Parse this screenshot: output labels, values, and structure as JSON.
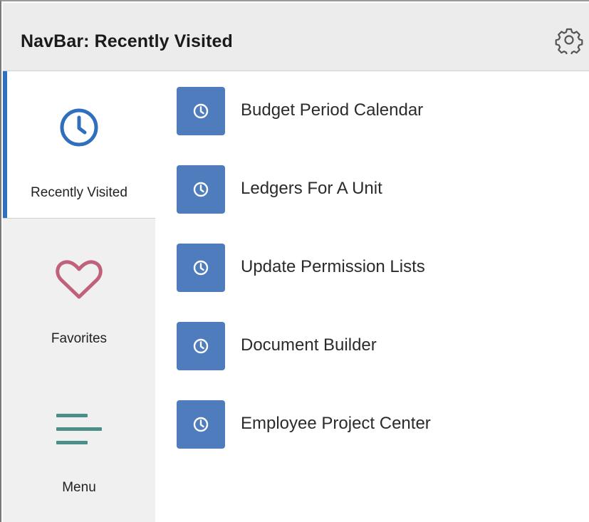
{
  "header": {
    "title": "NavBar: Recently Visited",
    "settings_icon": "gear-icon"
  },
  "sidebar": {
    "items": [
      {
        "label": "Recently Visited",
        "icon": "clock-icon",
        "active": true,
        "color": "#2f6fbd"
      },
      {
        "label": "Favorites",
        "icon": "heart-icon",
        "active": false,
        "color": "#c0607a"
      },
      {
        "label": "Menu",
        "icon": "menu-icon",
        "active": false,
        "color": "#4a8f87"
      }
    ]
  },
  "recent_items": [
    {
      "label": "Budget Period Calendar",
      "icon": "clock-icon"
    },
    {
      "label": "Ledgers For A Unit",
      "icon": "clock-icon"
    },
    {
      "label": "Update Permission Lists",
      "icon": "clock-icon"
    },
    {
      "label": "Document Builder",
      "icon": "clock-icon"
    },
    {
      "label": "Employee Project Center",
      "icon": "clock-icon"
    }
  ],
  "colors": {
    "tile": "#4f7cbd",
    "active_accent": "#2f6fbd",
    "header_bg": "#ececec",
    "sidebar_bg": "#f0f0f0"
  }
}
